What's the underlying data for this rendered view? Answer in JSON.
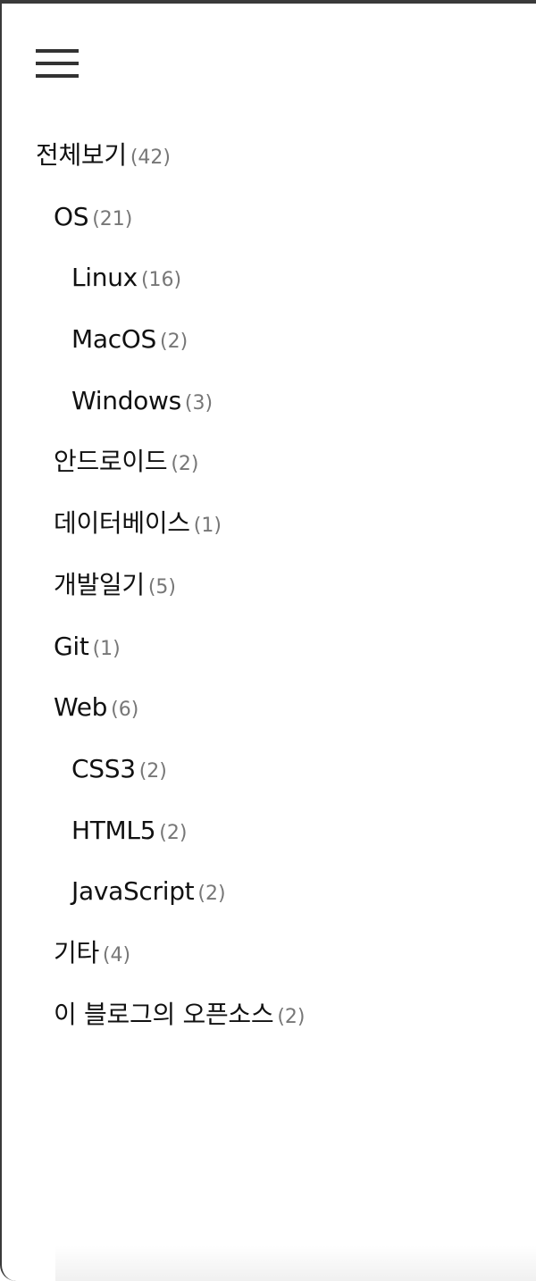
{
  "menu": {
    "icon": "hamburger-menu-icon"
  },
  "categories": [
    {
      "name": "전체보기",
      "count": "(42)",
      "level": 0
    },
    {
      "name": "OS",
      "count": "(21)",
      "level": 1
    },
    {
      "name": "Linux",
      "count": "(16)",
      "level": 2
    },
    {
      "name": "MacOS",
      "count": "(2)",
      "level": 2
    },
    {
      "name": "Windows",
      "count": "(3)",
      "level": 2
    },
    {
      "name": "안드로이드",
      "count": "(2)",
      "level": 1
    },
    {
      "name": "데이터베이스",
      "count": "(1)",
      "level": 1
    },
    {
      "name": "개발일기",
      "count": "(5)",
      "level": 1
    },
    {
      "name": "Git",
      "count": "(1)",
      "level": 1
    },
    {
      "name": "Web",
      "count": "(6)",
      "level": 1
    },
    {
      "name": "CSS3",
      "count": "(2)",
      "level": 2
    },
    {
      "name": "HTML5",
      "count": "(2)",
      "level": 2
    },
    {
      "name": "JavaScript",
      "count": "(2)",
      "level": 2
    },
    {
      "name": "기타",
      "count": "(4)",
      "level": 1
    },
    {
      "name": "이 블로그의 오픈소스",
      "count": "(2)",
      "level": 1
    }
  ]
}
